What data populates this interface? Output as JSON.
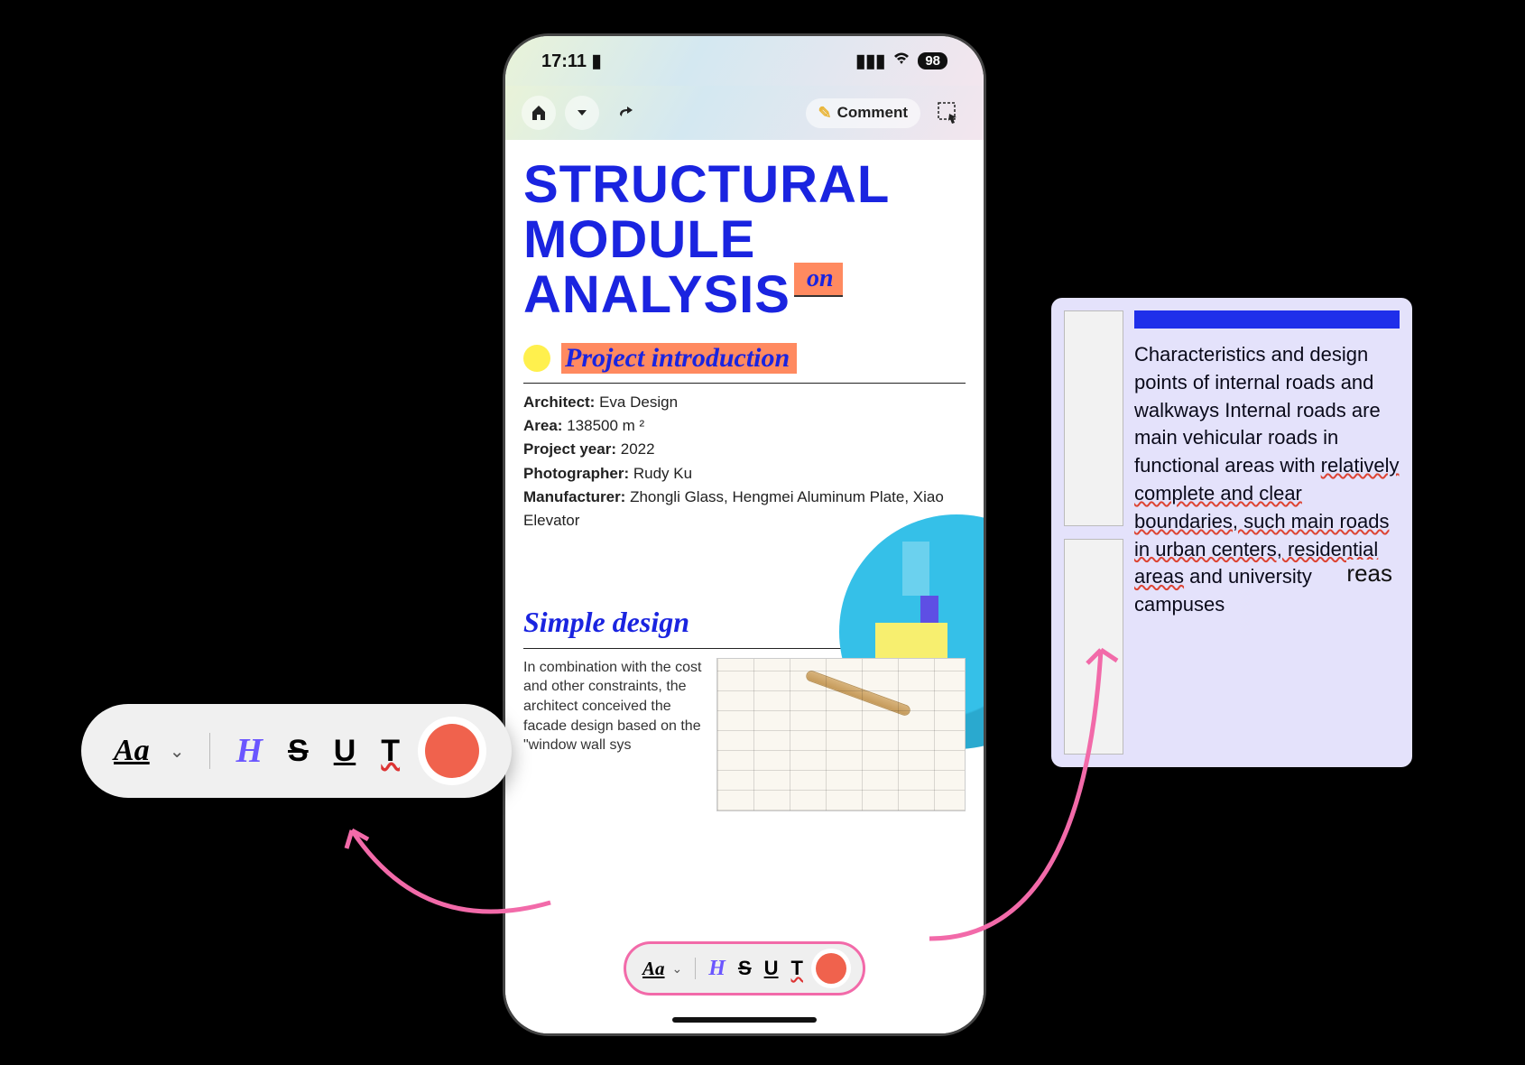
{
  "statusbar": {
    "time": "17:11",
    "battery": "98"
  },
  "toolbar": {
    "comment_label": "Comment"
  },
  "document": {
    "title_line1": "STRUCTURAL MODULE",
    "title_line2": "ANALYSIS",
    "sticker": "on",
    "intro_label": "Project introduction",
    "meta": {
      "architect_label": "Architect:",
      "architect_value": "Eva Design",
      "area_label": "Area:",
      "area_value": "138500 m ²",
      "year_label": "Project year:",
      "year_value": "2022",
      "photographer_label": "Photographer:",
      "photographer_value": "Rudy Ku",
      "manufacturer_label": "Manufacturer:",
      "manufacturer_value": "Zhongli Glass, Hengmei Aluminum Plate, Xiao Elevator"
    },
    "simple_design_title": "Simple design",
    "simple_design_body": "In combination with the cost and other constraints, the architect conceived the facade design based on the \"window wall sys"
  },
  "format_bar": {
    "font_button": "Aa",
    "heading_button": "H",
    "strike_button": "S",
    "underline_button": "U",
    "text_button": "T"
  },
  "sidecard": {
    "body_plain1": "Characteristics and design points of internal roads and walkways Internal roads are main vehicular roads in functional areas with ",
    "body_wavy": "relatively complete and clear boundaries, such main roads in urban centers, residential areas",
    "body_plain2": " and university campuses",
    "floating_fragment": "reas"
  }
}
